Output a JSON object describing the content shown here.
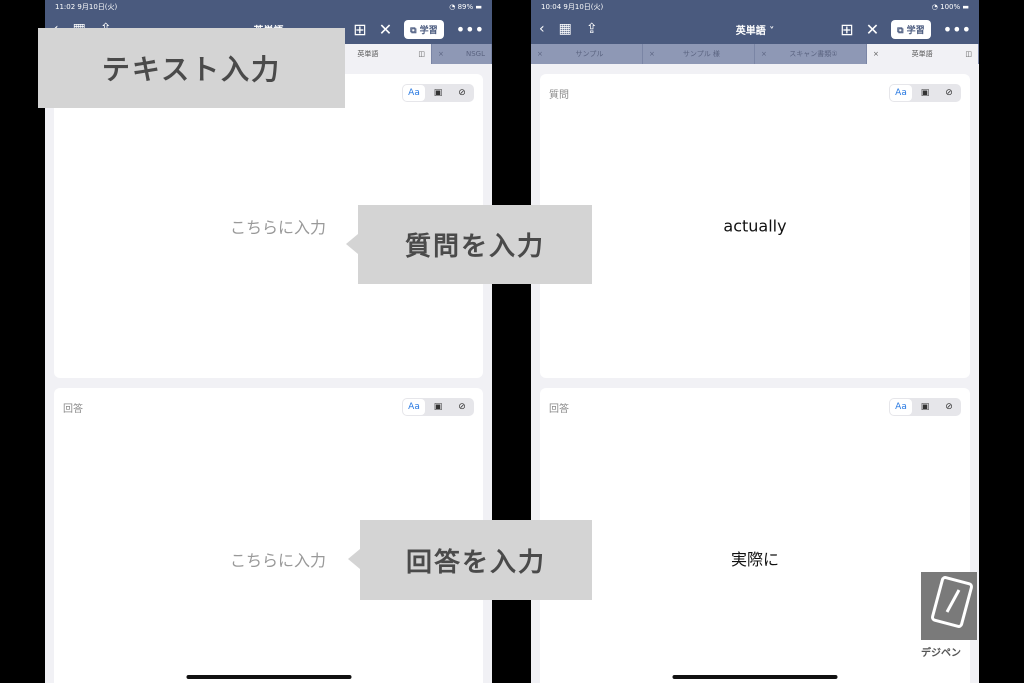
{
  "left": {
    "status": {
      "time": "11:02",
      "date": "9月10日(火)",
      "battery": "89%"
    },
    "title": "英単語",
    "study_label": "学習",
    "tabs": [
      {
        "label": "英単語",
        "active": true
      },
      {
        "label": "NSGL",
        "active": false
      }
    ],
    "cards": [
      {
        "label": "",
        "placeholder": "こちらに入力"
      },
      {
        "label": "回答",
        "placeholder": "こちらに入力"
      }
    ]
  },
  "right": {
    "status": {
      "time": "10:04",
      "date": "9月10日(火)",
      "battery": "100%"
    },
    "title": "英単語",
    "study_label": "学習",
    "tabs": [
      {
        "label": "サンプル"
      },
      {
        "label": "サンプル 様"
      },
      {
        "label": "スキャン書類①"
      },
      {
        "label": "英単語",
        "active": true
      }
    ],
    "cards": [
      {
        "label": "質問",
        "value": "actually"
      },
      {
        "label": "回答",
        "value": "実際に"
      }
    ]
  },
  "format_buttons": {
    "text": "Aa"
  },
  "overlays": {
    "text_input": "テキスト入力",
    "question_input": "質問を入力",
    "answer_input": "回答を入力"
  },
  "logo": "デジペン",
  "colors": {
    "toolbar": "#4a5a7e",
    "overlay": "#d4d4d4",
    "accent": "#2a7ae2"
  }
}
